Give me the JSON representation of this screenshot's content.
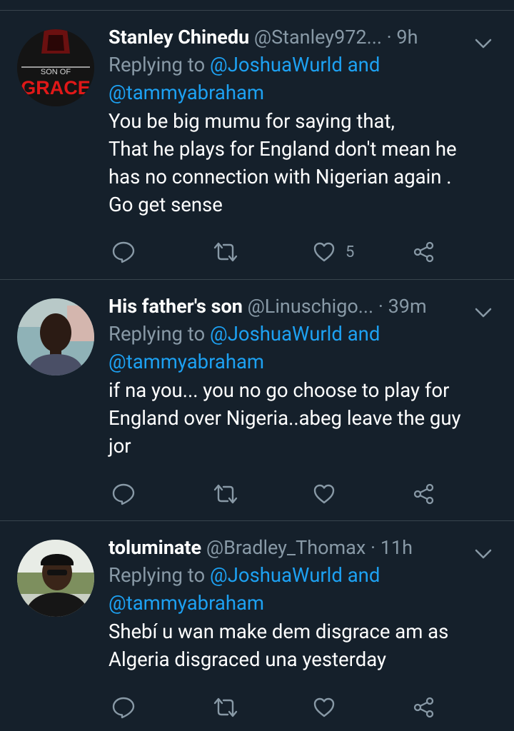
{
  "tweets": [
    {
      "name": "Stanley Chinedu",
      "handle": "@Stanley972...",
      "time": "· 9h",
      "replying_prefix": "Replying to",
      "mention1": "@JoshuaWurld and",
      "mention2": "@tammyabraham",
      "text": "You be big mumu for saying that,\nThat he plays for England don't mean he has no connection with Nigerian again .\nGo get sense",
      "likes": "5",
      "avatar_text_top": "SON OF",
      "avatar_text_bottom": "GRACE"
    },
    {
      "name": "His father's son",
      "handle": "@Linuschigo...",
      "time": "· 39m",
      "replying_prefix": "Replying to",
      "mention1": "@JoshuaWurld and",
      "mention2": "@tammyabraham",
      "text": "if na you... you no go choose to play for England over Nigeria..abeg leave the guy jor",
      "likes": ""
    },
    {
      "name": "toluminate",
      "handle": "@Bradley_Thomax",
      "time": "· 11h",
      "replying_prefix": "Replying to",
      "mention1": "@JoshuaWurld and",
      "mention2": "@tammyabraham",
      "text": "Shebí u wan make dem disgrace am as Algeria disgraced una yesterday",
      "likes": ""
    }
  ],
  "colors": {
    "background": "#15202b",
    "divider": "#38444d",
    "secondary_text": "#8899a6",
    "link": "#1da1f2"
  },
  "icons": [
    "reply-icon",
    "retweet-icon",
    "like-icon",
    "share-icon",
    "chevron-down-icon"
  ]
}
